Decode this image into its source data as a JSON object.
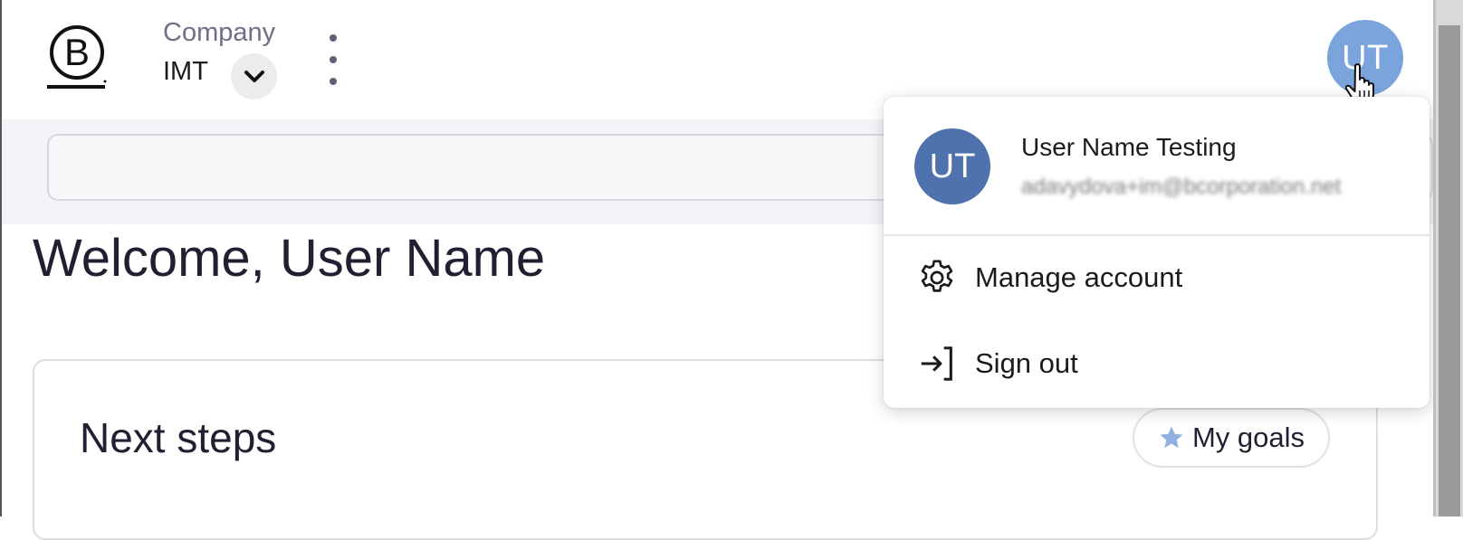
{
  "header": {
    "company_label": "Company",
    "company_name": "IMT",
    "avatar_initials": "UT"
  },
  "main": {
    "welcome": "Welcome, User Name",
    "next_steps_title": "Next steps",
    "my_goals_label": "My goals"
  },
  "account_menu": {
    "avatar_initials": "UT",
    "user_name": "User Name Testing",
    "email": "adavydova+im@bcorporation.net",
    "items": [
      {
        "label": "Manage account",
        "icon": "gear-icon"
      },
      {
        "label": "Sign out",
        "icon": "sign-out-icon"
      }
    ]
  },
  "colors": {
    "avatar_top": "#7ba4dc",
    "avatar_menu": "#4d72ad",
    "star": "#90b0e0"
  }
}
